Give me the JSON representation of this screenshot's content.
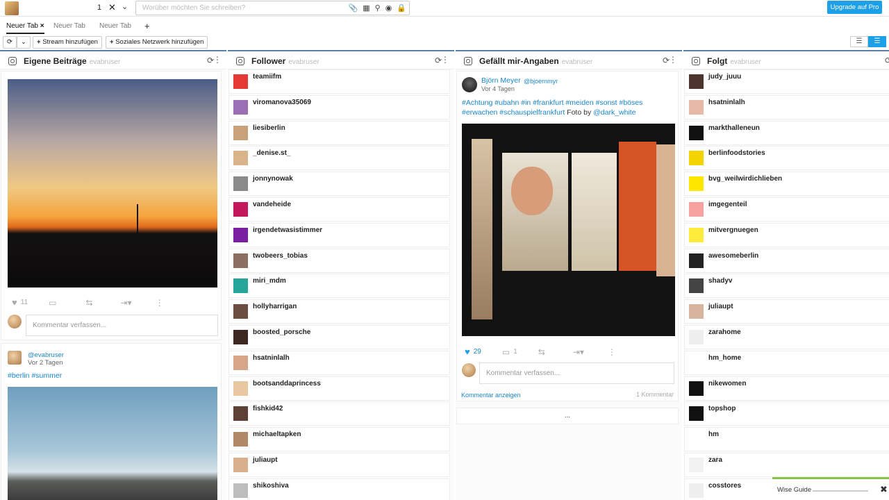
{
  "composer": {
    "count": "1",
    "placeholder": "Worüber möchten Sie schreiben?",
    "upgrade": "Upgrade auf Pro"
  },
  "tabs": [
    {
      "label": "Neuer Tab",
      "close": "×"
    },
    {
      "label": "Neuer Tab"
    },
    {
      "label": "Neuer Tab"
    },
    {
      "label": "+"
    }
  ],
  "toolbar": {
    "add_stream": "Stream hinzufügen",
    "add_network": "Soziales Netzwerk hinzufügen"
  },
  "columns": {
    "own": {
      "title": "Eigene Beiträge",
      "user": "evabruser",
      "post1": {
        "likes": "11",
        "comment_placeholder": "Kommentar verfassen..."
      },
      "post2": {
        "author": "@evabruser",
        "time": "Vor 2 Tagen",
        "text": "#berlin #summer"
      }
    },
    "followers": {
      "title": "Follower",
      "user": "evabruser",
      "items": [
        "teamiifm",
        "viromanova35069",
        "liesiberlin",
        "_denise.st_",
        "jonnynowak",
        "vandeheide",
        "irgendetwasistimmer",
        "twobeers_tobias",
        "miri_mdm",
        "hollyharrigan",
        "boosted_porsche",
        "hsatninlalh",
        "bootsanddaprincess",
        "fishkid42",
        "michaeltapken",
        "juliaupt",
        "shikoshiva"
      ]
    },
    "likes": {
      "title": "Gefällt mir-Angaben",
      "user": "evabruser",
      "post": {
        "name": "Björn Meyer",
        "handle": "@bjoernmyr",
        "time": "Vor 4 Tagen",
        "text_tags": "#Achtung #ubahn #in #frankfurt #meiden #sonst #böses #erwachen #schauspielfrankfurt",
        "text_plain": " Foto by ",
        "text_mention": "@dark_white",
        "likes": "29",
        "comments": "1",
        "comment_placeholder": "Kommentar verfassen...",
        "show_comments": "Kommentar anzeigen",
        "comment_count": "1 Kommentar",
        "more": "..."
      }
    },
    "follows": {
      "title": "Folgt",
      "user": "evabruser",
      "items": [
        "judy_juuu",
        "hsatninlalh",
        "markthalleneun",
        "berlinfoodstories",
        "bvg_weilwirdichlieben",
        "imgegenteil",
        "mitvergnuegen",
        "awesomeberlin",
        "shadyv",
        "juliaupt",
        "zarahome",
        "hm_home",
        "nikewomen",
        "topshop",
        "hm",
        "zara",
        "cosstores"
      ]
    }
  },
  "wise": {
    "label": "Wise Guide",
    "close": "✖"
  }
}
